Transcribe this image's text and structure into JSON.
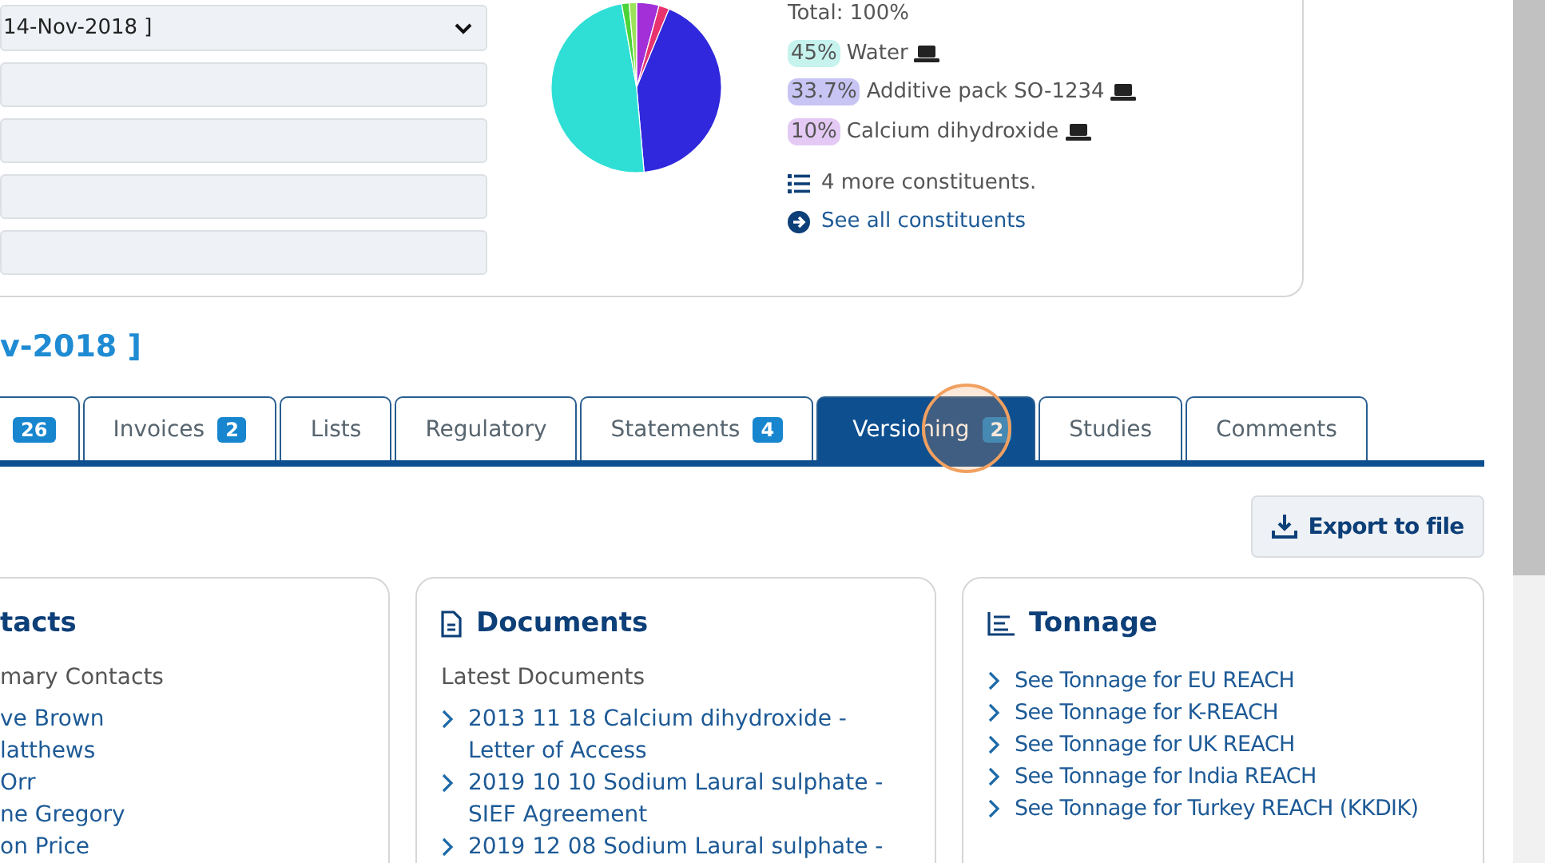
{
  "filters": {
    "select": {
      "value": "14-Nov-2018 ]"
    },
    "fields": [
      {
        "kind": "text"
      },
      {
        "kind": "text"
      },
      {
        "kind": "text"
      },
      {
        "kind": "text"
      }
    ]
  },
  "composition": {
    "total": "Total: 100%",
    "constituents": [
      {
        "percent": "45%",
        "name": "Water",
        "color": "#c6f3ee"
      },
      {
        "percent": "33.7%",
        "name": "Additive pack SO-1234",
        "color": "#c8c4f4"
      },
      {
        "percent": "10%",
        "name": "Calcium dihydroxide",
        "color": "#e4c9f4"
      }
    ],
    "more": "4 more constituents.",
    "see_all": "See all constituents"
  },
  "heading": "v-2018 ]",
  "tabs": [
    {
      "badge": "26",
      "selected": false
    },
    {
      "label": "Invoices",
      "badge": "2",
      "selected": false
    },
    {
      "label": "Lists",
      "selected": false
    },
    {
      "label": "Regulatory",
      "selected": false
    },
    {
      "label": "Statements",
      "badge": "4",
      "selected": false
    },
    {
      "label": "Versioning",
      "badge": "2",
      "selected": true
    },
    {
      "label": "Studies",
      "selected": false
    },
    {
      "label": "Comments",
      "selected": false
    }
  ],
  "export_button": "Export to file",
  "cards": [
    {
      "kind": "contacts",
      "title": "tacts",
      "subtitle": "mary Contacts",
      "items": [
        "ve Brown",
        "latthews",
        "Orr",
        "ne Gregory",
        "on Price"
      ]
    },
    {
      "kind": "documents",
      "title": "Documents",
      "subtitle": "Latest Documents",
      "items": [
        "2013 11 18 Calcium dihydroxide - Letter of Access",
        "2019 10 10 Sodium Laural sulphate - SIEF Agreement",
        "2019 12 08 Sodium Laural sulphate -"
      ]
    },
    {
      "kind": "tonnage",
      "title": "Tonnage",
      "items": [
        "See Tonnage for EU REACH",
        "See Tonnage for K-REACH",
        "See Tonnage for UK REACH",
        "See Tonnage for India REACH",
        "See Tonnage for Turkey REACH (KKDIK)"
      ]
    }
  ]
}
